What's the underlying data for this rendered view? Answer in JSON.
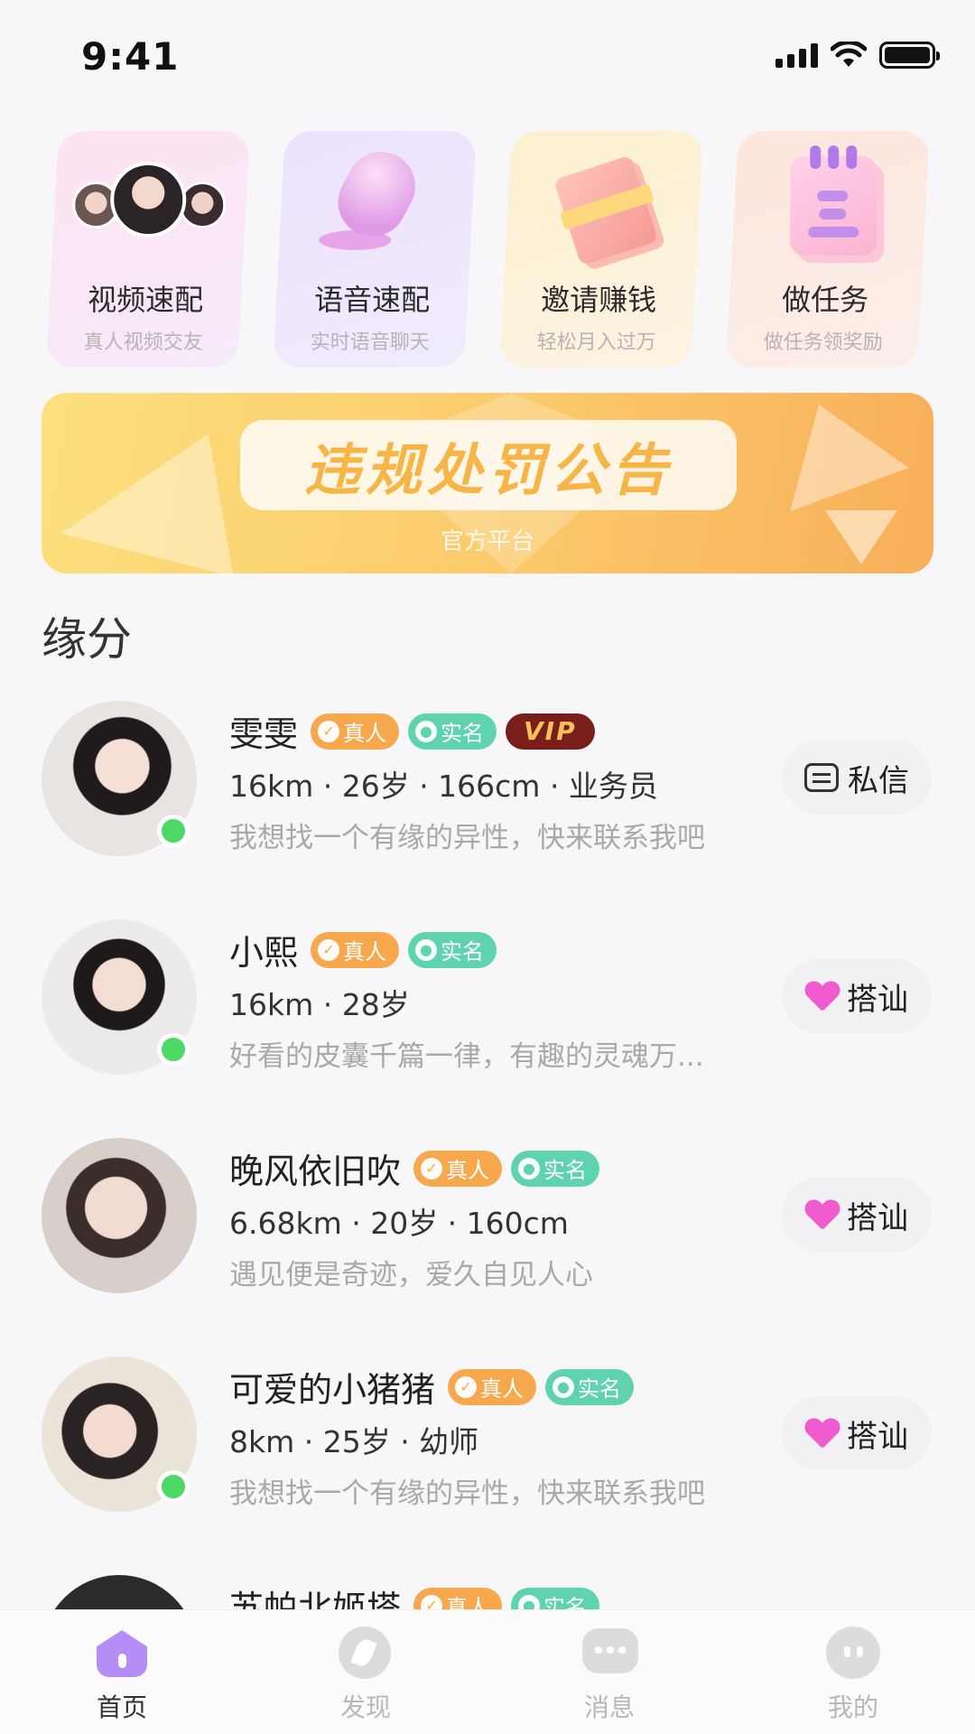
{
  "status_bar": {
    "time": "9:41"
  },
  "features": [
    {
      "title": "视频速配",
      "subtitle": "真人视频交友",
      "icon": "video-match-avatars-icon"
    },
    {
      "title": "语音速配",
      "subtitle": "实时语音聊天",
      "icon": "microphone-icon"
    },
    {
      "title": "邀请赚钱",
      "subtitle": "轻松月入过万",
      "icon": "cash-stack-icon"
    },
    {
      "title": "做任务",
      "subtitle": "做任务领奖励",
      "icon": "notebook-icon"
    }
  ],
  "banner": {
    "title": "违规处罚公告",
    "subtitle": "官方平台"
  },
  "section": {
    "title": "缘分"
  },
  "badges": {
    "real": "真人",
    "verified": "实名",
    "vip": "VIP"
  },
  "users": [
    {
      "name": "雯雯",
      "meta": "16km · 26岁 · 166cm · 业务员",
      "bio": "我想找一个有缘的异性，快来联系我吧",
      "action": "私信",
      "action_icon": "message-icon",
      "online": true,
      "vip": true
    },
    {
      "name": "小熙",
      "meta": "16km · 28岁",
      "bio": "好看的皮囊千篇一律，有趣的灵魂万...",
      "action": "搭讪",
      "action_icon": "heart-icon",
      "online": true,
      "vip": false
    },
    {
      "name": "晚风依旧吹",
      "meta": "6.68km · 20岁 · 160cm",
      "bio": "遇见便是奇迹，爱久自见人心",
      "action": "搭讪",
      "action_icon": "heart-icon",
      "online": false,
      "vip": false
    },
    {
      "name": "可爱的小猪猪",
      "meta": "8km · 25岁 · 幼师",
      "bio": "我想找一个有缘的异性，快来联系我吧",
      "action": "搭讪",
      "action_icon": "heart-icon",
      "online": true,
      "vip": false
    },
    {
      "name": "苏帕北姬塔",
      "meta": "",
      "bio": "",
      "action": "",
      "online": false,
      "vip": false
    }
  ],
  "tabbar": [
    {
      "label": "首页",
      "active": true
    },
    {
      "label": "发现",
      "active": false
    },
    {
      "label": "消息",
      "active": false
    },
    {
      "label": "我的",
      "active": false
    }
  ],
  "colors": {
    "accent_purple": "#b68cf7",
    "online_green": "#4cd964",
    "real_badge": "#f7a74c",
    "verified_badge": "#5ed3ad",
    "heart_pink": "#f05bd0"
  }
}
